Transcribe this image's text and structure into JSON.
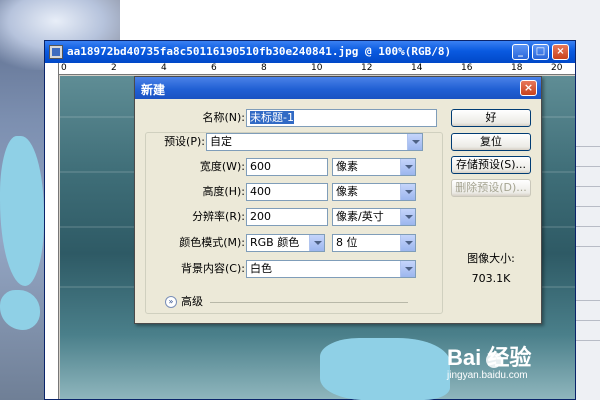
{
  "document": {
    "title": "aa18972bd40735fa8c50116190510fb30e240841.jpg @ 100%(RGB/8)",
    "window_buttons": {
      "minimize": "_",
      "maximize": "□",
      "close": "×"
    },
    "ruler_ticks": [
      "0",
      "2",
      "4",
      "6",
      "8",
      "10",
      "12",
      "14",
      "16",
      "18",
      "20"
    ]
  },
  "dialog": {
    "title": "新建",
    "close": "×",
    "name": {
      "label": "名称(N):",
      "value": "未标题-1"
    },
    "preset": {
      "label": "预设(P):",
      "value": "自定"
    },
    "width": {
      "label": "宽度(W):",
      "value": "600",
      "unit": "像素"
    },
    "height": {
      "label": "高度(H):",
      "value": "400",
      "unit": "像素"
    },
    "resolution": {
      "label": "分辨率(R):",
      "value": "200",
      "unit": "像素/英寸"
    },
    "color_mode": {
      "label": "颜色模式(M):",
      "value": "RGB 颜色",
      "depth": "8 位"
    },
    "background": {
      "label": "背景内容(C):",
      "value": "白色"
    },
    "advanced": {
      "label": "高级",
      "icon": "»"
    },
    "buttons": {
      "ok": "好",
      "reset": "复位",
      "save_preset": "存储预设(S)...",
      "delete_preset": "删除预设(D)..."
    },
    "image_size": {
      "label": "图像大小:",
      "value": "703.1K"
    }
  },
  "watermark": {
    "brand": "Bai  经验",
    "url": "jingyan.baidu.com"
  }
}
